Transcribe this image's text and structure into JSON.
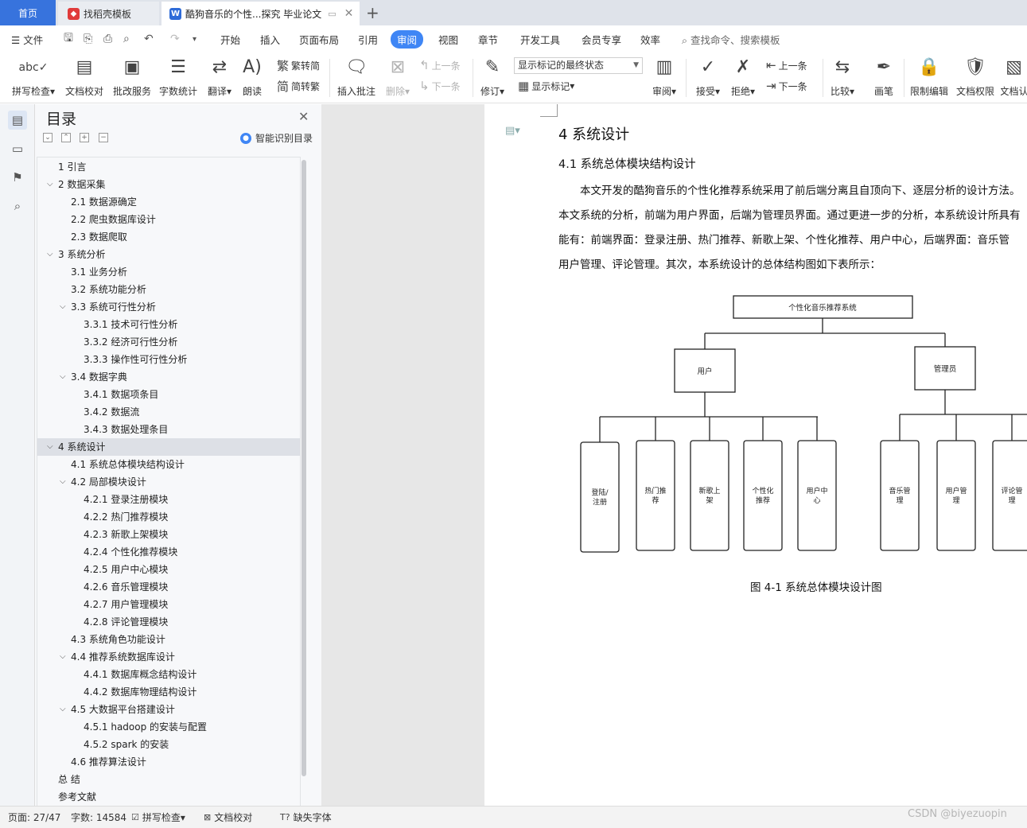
{
  "tabs": {
    "home": "首页",
    "template": "找稻壳模板",
    "document": "酷狗音乐的个性...探究 毕业论文"
  },
  "menu": {
    "file": "文件",
    "items": [
      "开始",
      "插入",
      "页面布局",
      "引用",
      "审阅",
      "视图",
      "章节",
      "开发工具",
      "会员专享",
      "效率"
    ],
    "active": "审阅",
    "search": "查找命令、搜索模板"
  },
  "ribbon": {
    "spellcheck": "拼写检查",
    "doc_proof": "文档校对",
    "batch_service": "批改服务",
    "word_count": "字数统计",
    "translate": "翻译",
    "read_aloud": "朗读",
    "trad_convert": "繁转简",
    "simp_convert": "简转繁",
    "insert_comment": "插入批注",
    "delete": "删除",
    "prev_comment": "上一条",
    "next_comment": "下一条",
    "track_changes": "修订",
    "markup_state": "显示标记的最终状态",
    "show_markup": "显示标记",
    "review": "审阅",
    "accept": "接受",
    "reject": "拒绝",
    "prev_change": "上一条",
    "next_change": "下一条",
    "compare": "比较",
    "pen": "画笔",
    "restrict_edit": "限制编辑",
    "doc_permission": "文档权限",
    "doc_more": "文档认"
  },
  "toc": {
    "title": "目录",
    "smart_label": "智能识别目录",
    "items": [
      {
        "text": "1 引言",
        "level": 0,
        "expand": false
      },
      {
        "text": "2 数据采集",
        "level": 0,
        "expand": true
      },
      {
        "text": "2.1 数据源确定",
        "level": 1,
        "expand": false
      },
      {
        "text": "2.2 爬虫数据库设计",
        "level": 1,
        "expand": false
      },
      {
        "text": "2.3 数据爬取",
        "level": 1,
        "expand": false
      },
      {
        "text": "3 系统分析",
        "level": 0,
        "expand": true
      },
      {
        "text": "3.1 业务分析",
        "level": 1,
        "expand": false
      },
      {
        "text": "3.2 系统功能分析",
        "level": 1,
        "expand": false
      },
      {
        "text": "3.3  系统可行性分析",
        "level": 1,
        "expand": true
      },
      {
        "text": "3.3.1  技术可行性分析",
        "level": 2,
        "expand": false
      },
      {
        "text": "3.3.2  经济可行性分析",
        "level": 2,
        "expand": false
      },
      {
        "text": "3.3.3  操作性可行性分析",
        "level": 2,
        "expand": false
      },
      {
        "text": "3.4  数据字典",
        "level": 1,
        "expand": true
      },
      {
        "text": "3.4.1  数据项条目",
        "level": 2,
        "expand": false
      },
      {
        "text": "3.4.2  数据流",
        "level": 2,
        "expand": false
      },
      {
        "text": "3.4.3  数据处理条目",
        "level": 2,
        "expand": false
      },
      {
        "text": "4  系统设计",
        "level": 0,
        "expand": true,
        "selected": true
      },
      {
        "text": "4.1 系统总体模块结构设计",
        "level": 1,
        "expand": false
      },
      {
        "text": "4.2  局部模块设计",
        "level": 1,
        "expand": true
      },
      {
        "text": "4.2.1  登录注册模块",
        "level": 2,
        "expand": false
      },
      {
        "text": "4.2.2  热门推荐模块",
        "level": 2,
        "expand": false
      },
      {
        "text": "4.2.3  新歌上架模块",
        "level": 2,
        "expand": false
      },
      {
        "text": "4.2.4  个性化推荐模块",
        "level": 2,
        "expand": false
      },
      {
        "text": "4.2.5  用户中心模块",
        "level": 2,
        "expand": false
      },
      {
        "text": "4.2.6  音乐管理模块",
        "level": 2,
        "expand": false
      },
      {
        "text": "4.2.7  用户管理模块",
        "level": 2,
        "expand": false
      },
      {
        "text": "4.2.8  评论管理模块",
        "level": 2,
        "expand": false
      },
      {
        "text": "4.3  系统角色功能设计",
        "level": 1,
        "expand": false
      },
      {
        "text": "4.4  推荐系统数据库设计",
        "level": 1,
        "expand": true
      },
      {
        "text": "4.4.1  数据库概念结构设计",
        "level": 2,
        "expand": false
      },
      {
        "text": "4.4.2  数据库物理结构设计",
        "level": 2,
        "expand": false
      },
      {
        "text": "4.5  大数据平台搭建设计",
        "level": 1,
        "expand": true
      },
      {
        "text": "4.5.1 hadoop 的安装与配置",
        "level": 2,
        "expand": false
      },
      {
        "text": "4.5.2 spark 的安装",
        "level": 2,
        "expand": false
      },
      {
        "text": "4.6  推荐算法设计",
        "level": 1,
        "expand": false
      },
      {
        "text": "总    结",
        "level": 0,
        "expand": false
      },
      {
        "text": "参考文献",
        "level": 0,
        "expand": false
      }
    ]
  },
  "document": {
    "heading": "4  系统设计",
    "subheading": "4.1 系统总体模块结构设计",
    "para": [
      "本文开发的酷狗音乐的个性化推荐系统采用了前后端分离且自顶向下、逐层分析的设计方法。",
      "本文系统的分析，前端为用户界面，后端为管理员界面。通过更进一步的分析，本系统设计所具有",
      "能有：前端界面：登录注册、热门推荐、新歌上架、个性化推荐、用户中心，后端界面：音乐管",
      "用户管理、评论管理。其次，本系统设计的总体结构图如下表所示："
    ],
    "caption": "图 4-1  系统总体模块设计图"
  },
  "diagram": {
    "root": "个性化音乐推荐系统",
    "user": "用户",
    "admin": "管理员",
    "user_modules": [
      [
        "登陆/",
        "注册"
      ],
      [
        "热门推",
        "荐"
      ],
      [
        "新歌上",
        "架"
      ],
      [
        "个性化",
        "推荐"
      ],
      [
        "用户中",
        "心"
      ]
    ],
    "admin_modules": [
      [
        "音乐管",
        "理"
      ],
      [
        "用户管",
        "理"
      ],
      [
        "评论管",
        "理"
      ]
    ]
  },
  "status": {
    "page": "页面: 27/47",
    "words": "字数: 14584",
    "spell": "拼写检查",
    "proof": "文档校对",
    "missing_font": "缺失字体"
  },
  "watermark": "CSDN @biyezuopin",
  "colors": {
    "accent": "#3f86f5",
    "home_tab": "#3773dd",
    "wps_red": "#e03a3a",
    "wps_blue": "#2e6bd8"
  }
}
